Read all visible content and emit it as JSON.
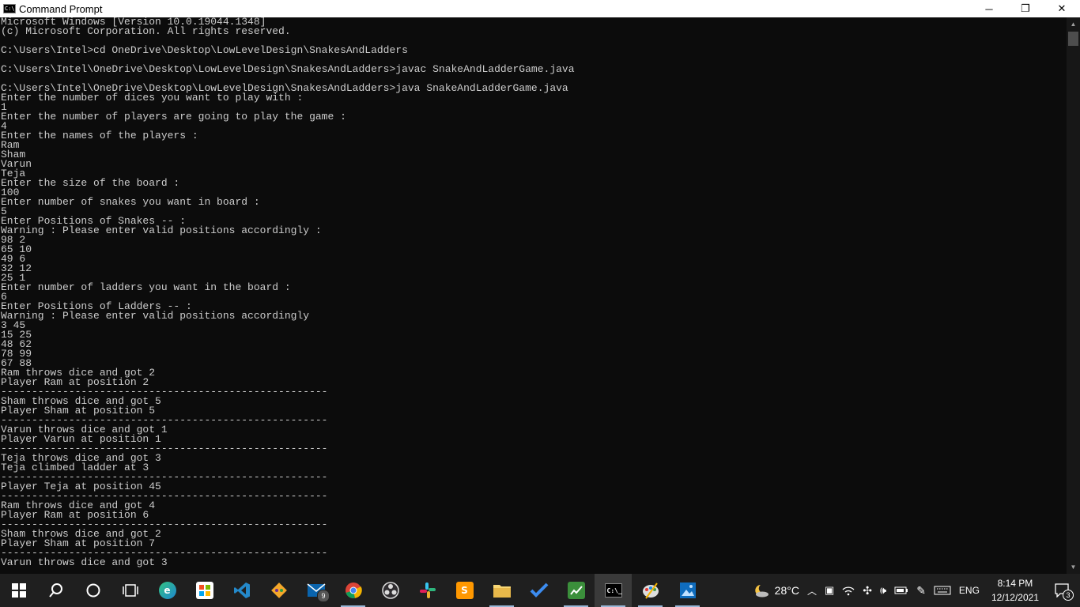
{
  "window": {
    "title": "Command Prompt",
    "icon_label": "C:\\_",
    "minimize": "─",
    "restore": "❐",
    "close": "✕"
  },
  "console": {
    "lines": [
      "Microsoft Windows [Version 10.0.19044.1348]",
      "(c) Microsoft Corporation. All rights reserved.",
      "",
      "C:\\Users\\Intel>cd OneDrive\\Desktop\\LowLevelDesign\\SnakesAndLadders",
      "",
      "C:\\Users\\Intel\\OneDrive\\Desktop\\LowLevelDesign\\SnakesAndLadders>javac SnakeAndLadderGame.java",
      "",
      "C:\\Users\\Intel\\OneDrive\\Desktop\\LowLevelDesign\\SnakesAndLadders>java SnakeAndLadderGame.java",
      "Enter the number of dices you want to play with :",
      "1",
      "Enter the number of players are going to play the game :",
      "4",
      "Enter the names of the players :",
      "Ram",
      "Sham",
      "Varun",
      "Teja",
      "Enter the size of the board :",
      "100",
      "Enter number of snakes you want in board :",
      "5",
      "Enter Positions of Snakes -- :",
      "Warning : Please enter valid positions accordingly :",
      "98 2",
      "65 10",
      "49 6",
      "32 12",
      "25 1",
      "Enter number of ladders you want in the board :",
      "6",
      "Enter Positions of Ladders -- :",
      "Warning : Please enter valid positions accordingly",
      "3 45",
      "15 25",
      "48 62",
      "78 99",
      "67 88",
      "Ram throws dice and got 2",
      "Player Ram at position 2",
      "-----------------------------------------------------",
      "Sham throws dice and got 5",
      "Player Sham at position 5",
      "-----------------------------------------------------",
      "Varun throws dice and got 1",
      "Player Varun at position 1",
      "-----------------------------------------------------",
      "Teja throws dice and got 3",
      "Teja climbed ladder at 3",
      "-----------------------------------------------------",
      "Player Teja at position 45",
      "-----------------------------------------------------",
      "Ram throws dice and got 4",
      "Player Ram at position 6",
      "-----------------------------------------------------",
      "Sham throws dice and got 2",
      "Player Sham at position 7",
      "-----------------------------------------------------",
      "Varun throws dice and got 3"
    ]
  },
  "taskbar": {
    "items": [
      {
        "name": "start-button",
        "icon": "windows-icon"
      },
      {
        "name": "search-button",
        "icon": "search-icon"
      },
      {
        "name": "cortana-button",
        "icon": "cortana-icon"
      },
      {
        "name": "task-view-button",
        "icon": "task-view-icon"
      },
      {
        "name": "edge-app",
        "icon": "edge-icon"
      },
      {
        "name": "store-app",
        "icon": "store-icon"
      },
      {
        "name": "vscode-app",
        "icon": "vscode-icon"
      },
      {
        "name": "git-app",
        "icon": "git-icon"
      },
      {
        "name": "mail-app",
        "icon": "mail-icon",
        "badge": "9"
      },
      {
        "name": "chrome-app",
        "icon": "chrome-icon"
      },
      {
        "name": "obs-app",
        "icon": "obs-icon"
      },
      {
        "name": "slack-app",
        "icon": "slack-icon"
      },
      {
        "name": "sublime-app",
        "icon": "sublime-icon"
      },
      {
        "name": "file-explorer-app",
        "icon": "folder-icon"
      },
      {
        "name": "todo-app",
        "icon": "checkmark-icon"
      },
      {
        "name": "task-manager-app",
        "icon": "chart-icon"
      },
      {
        "name": "command-prompt-app",
        "icon": "terminal-icon"
      },
      {
        "name": "paint-app",
        "icon": "paint-icon"
      },
      {
        "name": "photos-app",
        "icon": "photos-icon"
      }
    ],
    "weather": {
      "temp": "28°C",
      "icon": "night-cloud-icon"
    },
    "language": "ENG",
    "time": "8:14 PM",
    "date": "12/12/2021",
    "notification_count": "3",
    "colors": {
      "background": "#1f1f1f",
      "console_bg": "#0c0c0c",
      "console_text": "#cccccc"
    }
  }
}
